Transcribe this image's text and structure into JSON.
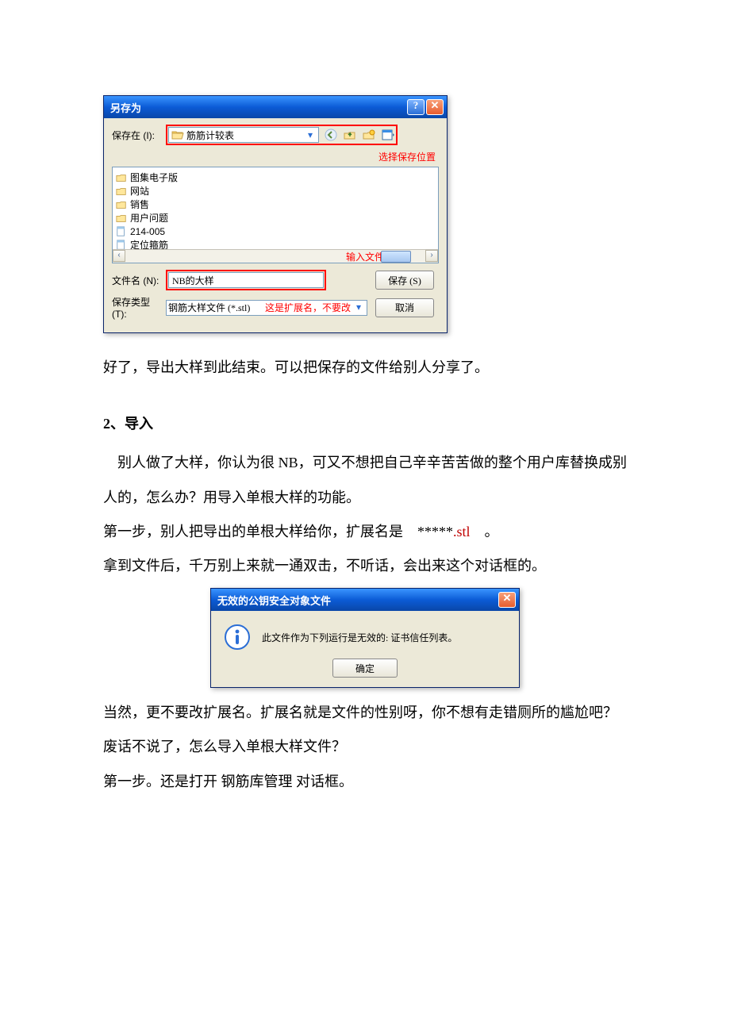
{
  "save_dialog": {
    "title": "另存为",
    "save_in_label": "保存在 (I):",
    "save_in_value": "筋筋计较表",
    "annotation_select_location": "选择保存位置",
    "file_list": [
      {
        "icon": "folder",
        "name": "图集电子版"
      },
      {
        "icon": "folder",
        "name": "网站"
      },
      {
        "icon": "folder",
        "name": "销售"
      },
      {
        "icon": "folder",
        "name": "用户问题"
      },
      {
        "icon": "doc",
        "name": "214-005"
      },
      {
        "icon": "doc",
        "name": "定位箍筋"
      }
    ],
    "annotation_enter_filename": "输入文件名",
    "filename_label": "文件名 (N):",
    "filename_value": "NB的大样",
    "filetype_label": "保存类型 (T):",
    "filetype_value": "钢筋大样文件 (*.stl)",
    "annotation_extension_note": "这是扩展名，不要改",
    "save_button": "保存 (S)",
    "cancel_button": "取消"
  },
  "prose": {
    "p1": "好了，导出大样到此结束。可以把保存的文件给别人分享了。",
    "h2": "2、导入",
    "p2": "别人做了大样，你认为很 NB，可又不想把自己辛辛苦苦做的整个用户库替换成别人的，怎么办？用导入单根大样的功能。",
    "p3_a": "第一步，别人把导出的单根大样给你，扩展名是　*****",
    "p3_ext": ".stl",
    "p3_b": "　。",
    "p4": "拿到文件后，千万别上来就一通双击，不听话，会出来这个对话框的。",
    "p5": "当然，更不要改扩展名。扩展名就是文件的性别呀，你不想有走错厕所的尴尬吧？",
    "p6": "废话不说了，怎么导入单根大样文件？",
    "p7": "第一步。还是打开 钢筋库管理 对话框。"
  },
  "error_dialog": {
    "title": "无效的公钥安全对象文件",
    "message": "此文件作为下列运行是无效的: 证书信任列表。",
    "ok_button": "确定"
  }
}
